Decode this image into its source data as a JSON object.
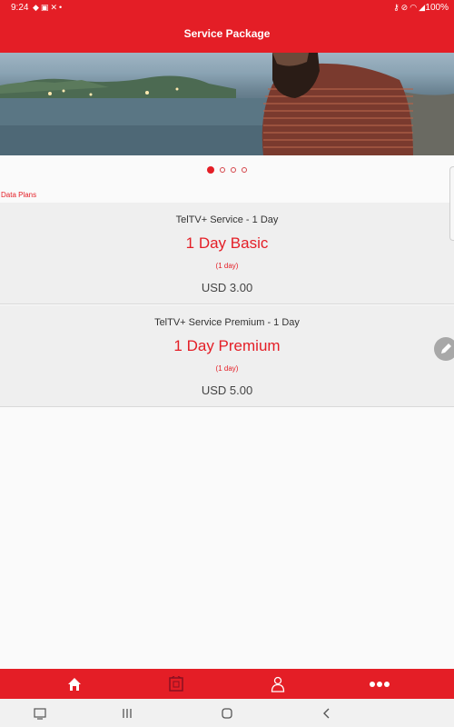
{
  "status_bar": {
    "time": "9:24",
    "left_icons": [
      "android-icon",
      "photo-icon",
      "tools-icon",
      "dot-icon"
    ],
    "right_icons": [
      "vpn-key-icon",
      "mute-icon",
      "wifi-icon",
      "signal-icon"
    ],
    "battery": "100%"
  },
  "app_bar": {
    "title": "Service Package"
  },
  "carousel": {
    "total": 4,
    "active_index": 0
  },
  "section": {
    "label": "Data Plans"
  },
  "plans": [
    {
      "service": "TelTV+ Service - 1 Day",
      "name": "1 Day Basic",
      "duration": "(1 day)",
      "price": "USD 3.00"
    },
    {
      "service": "TelTV+ Service Premium - 1 Day",
      "name": "1 Day Premium",
      "duration": "(1 day)",
      "price": "USD 5.00"
    }
  ],
  "bottom_nav": {
    "items": [
      {
        "icon": "home-icon"
      },
      {
        "icon": "tv-icon"
      },
      {
        "icon": "user-icon"
      },
      {
        "icon": "more-icon"
      }
    ]
  },
  "system_nav": {
    "items": [
      {
        "icon": "screenshot-icon"
      },
      {
        "icon": "recents-icon"
      },
      {
        "icon": "home-circle-icon"
      },
      {
        "icon": "back-icon"
      }
    ]
  },
  "colors": {
    "brand": "#e41e26",
    "fab": "#a8a8a8"
  }
}
